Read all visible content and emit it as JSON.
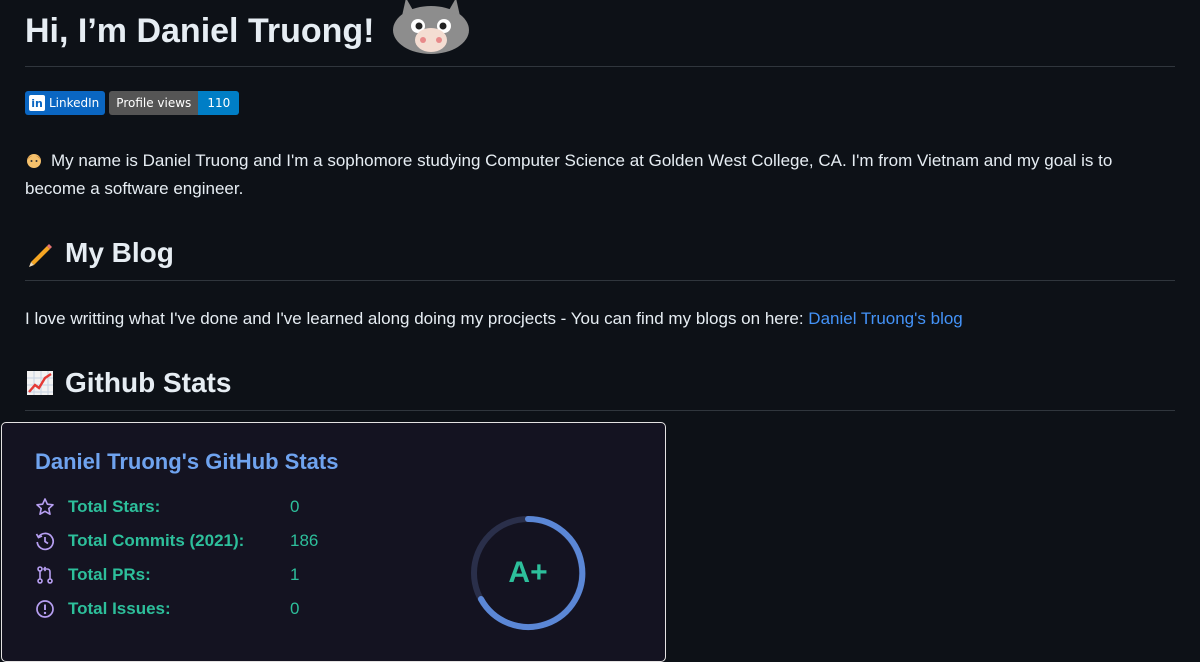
{
  "heading": {
    "title": "Hi, I’m Daniel Truong!"
  },
  "badges": {
    "linkedin": "LinkedIn",
    "profile_views_label": "Profile views",
    "profile_views_count": "110"
  },
  "intro": {
    "text": "My name is Daniel Truong and I'm a sophomore studying Computer Science at Golden West College, CA. I'm from Vietnam and my goal is to become a software engineer."
  },
  "blog": {
    "heading": "My Blog",
    "text": "I love writting what I've done and I've learned along doing my procjects - You can find my blogs on here: ",
    "link_text": "Daniel Truong's blog"
  },
  "stats": {
    "heading": "Github Stats",
    "card_title": "Daniel Truong's GitHub Stats",
    "rows": [
      {
        "icon": "star-icon",
        "label": "Total Stars:",
        "value": "0"
      },
      {
        "icon": "history-icon",
        "label": "Total Commits (2021):",
        "value": "186"
      },
      {
        "icon": "pull-request-icon",
        "label": "Total PRs:",
        "value": "1"
      },
      {
        "icon": "issue-icon",
        "label": "Total Issues:",
        "value": "0"
      }
    ],
    "rank": "A+",
    "colors": {
      "title": "#6fa3ef",
      "text": "#2dbf9b",
      "icon": "#b79ff2",
      "ring": "#5b87d6"
    }
  }
}
